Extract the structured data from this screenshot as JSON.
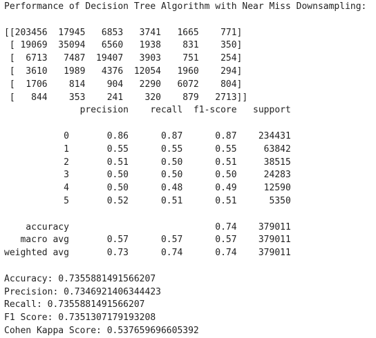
{
  "cell_output": {
    "title": "Performance of Decision Tree Algorithm with Near Miss Downsampling:",
    "confusion_matrix": [
      "[[203456  17945   6853   3741   1665    771]",
      " [ 19069  35094   6560   1938    831    350]",
      " [  6713   7487  19407   3903    751    254]",
      " [  3610   1989   4376  12054   1960    294]",
      " [  1706    814    904   2290   6072    804]",
      " [   844    353    241    320    879   2713]]"
    ],
    "report_header": "              precision    recall  f1-score   support",
    "report_rows": [
      "           0       0.86      0.87      0.87    234431",
      "           1       0.55      0.55      0.55     63842",
      "           2       0.51      0.50      0.51     38515",
      "           3       0.50      0.50      0.50     24283",
      "           4       0.50      0.48      0.49     12590",
      "           5       0.52      0.51      0.51      5350"
    ],
    "report_summary": [
      "    accuracy                           0.74    379011",
      "   macro avg       0.57      0.57      0.57    379011",
      "weighted avg       0.73      0.74      0.74    379011"
    ],
    "metrics": [
      "Accuracy: 0.7355881491566207",
      "Precision: 0.7346921406344423",
      "Recall: 0.7355881491566207",
      "F1 Score: 0.7351307179193208",
      "Cohen Kappa Score: 0.537659696605392"
    ]
  }
}
